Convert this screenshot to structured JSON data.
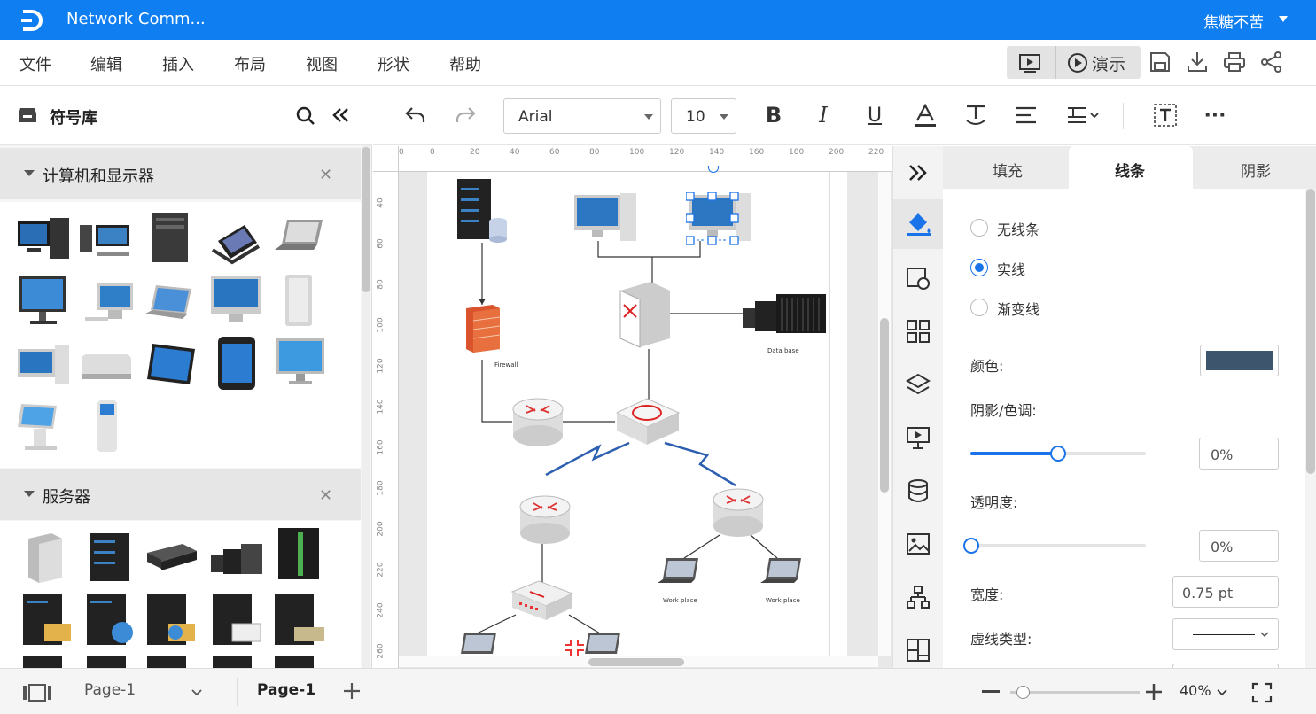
{
  "app": {
    "title": "Network Comm...",
    "user": "焦糖不苦"
  },
  "menu": [
    "文件",
    "编辑",
    "插入",
    "布局",
    "视图",
    "形状",
    "帮助"
  ],
  "present": {
    "label": "演示"
  },
  "library": {
    "title": "符号库",
    "sections": [
      {
        "title": "计算机和显示器"
      },
      {
        "title": "服务器"
      }
    ]
  },
  "toolbar": {
    "font": "Arial",
    "size": "10"
  },
  "ruler": {
    "top": [
      "0",
      "0",
      "20",
      "40",
      "60",
      "80",
      "100",
      "120",
      "140",
      "160",
      "180",
      "200",
      "220"
    ],
    "left": [
      "40",
      "60",
      "80",
      "100",
      "120",
      "140",
      "160",
      "180",
      "200",
      "220",
      "240",
      "260"
    ]
  },
  "diagram": {
    "firewall": "Firewall",
    "database": "Data base",
    "workplace": "Work place"
  },
  "panel": {
    "tabs": [
      "填充",
      "线条",
      "阴影"
    ],
    "active_tab": "线条",
    "line_options": [
      "无线条",
      "实线",
      "渐变线"
    ],
    "color_label": "颜色:",
    "color_value": "#3d566e",
    "shade_label": "阴影/色调:",
    "shade_value": "0%",
    "shade_level": 0.5,
    "opacity_label": "透明度:",
    "opacity_value": "0%",
    "width_label": "宽度:",
    "width_value": "0.75 pt",
    "dash_label": "虚线类型:"
  },
  "status": {
    "page_select": "Page-1",
    "page_tab": "Page-1",
    "zoom": "40%"
  }
}
